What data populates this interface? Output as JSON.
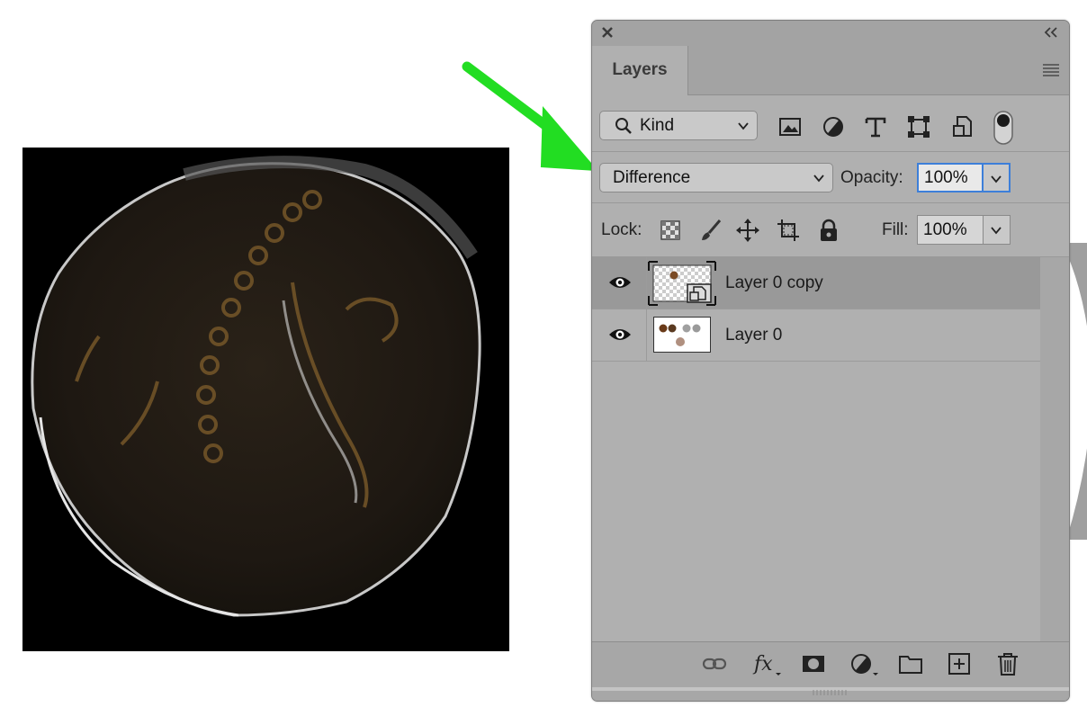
{
  "panel": {
    "tab_label": "Layers",
    "icons": {
      "close": "close-icon",
      "collapse": "double-chevron-left-icon",
      "menu": "hamburger-menu-icon"
    }
  },
  "filter": {
    "kind_label": "Kind",
    "icons": [
      "pixel-layer-filter-icon",
      "adjustment-layer-filter-icon",
      "type-layer-filter-icon",
      "shape-layer-filter-icon",
      "smart-object-filter-icon",
      "filter-toggle-icon"
    ]
  },
  "blend": {
    "mode": "Difference",
    "opacity_label": "Opacity:",
    "opacity_value": "100%"
  },
  "lock": {
    "label": "Lock:",
    "icons": [
      "lock-transparent-pixels-icon",
      "lock-image-pixels-icon",
      "lock-position-icon",
      "lock-artboard-icon",
      "lock-all-icon"
    ],
    "fill_label": "Fill:",
    "fill_value": "100%"
  },
  "layers": [
    {
      "name": "Layer 0 copy",
      "selected": true,
      "visible": true
    },
    {
      "name": "Layer 0",
      "selected": false,
      "visible": true
    }
  ],
  "bottom_icons": [
    "link-layers-icon",
    "layer-style-fx-icon",
    "add-mask-icon",
    "new-adjustment-layer-icon",
    "new-group-folder-icon",
    "new-layer-icon",
    "delete-layer-icon"
  ],
  "colors": {
    "arrow": "#22dd22",
    "focus": "#3d7fd9",
    "panel": "#b0b0b0",
    "selected_row": "#999999"
  }
}
